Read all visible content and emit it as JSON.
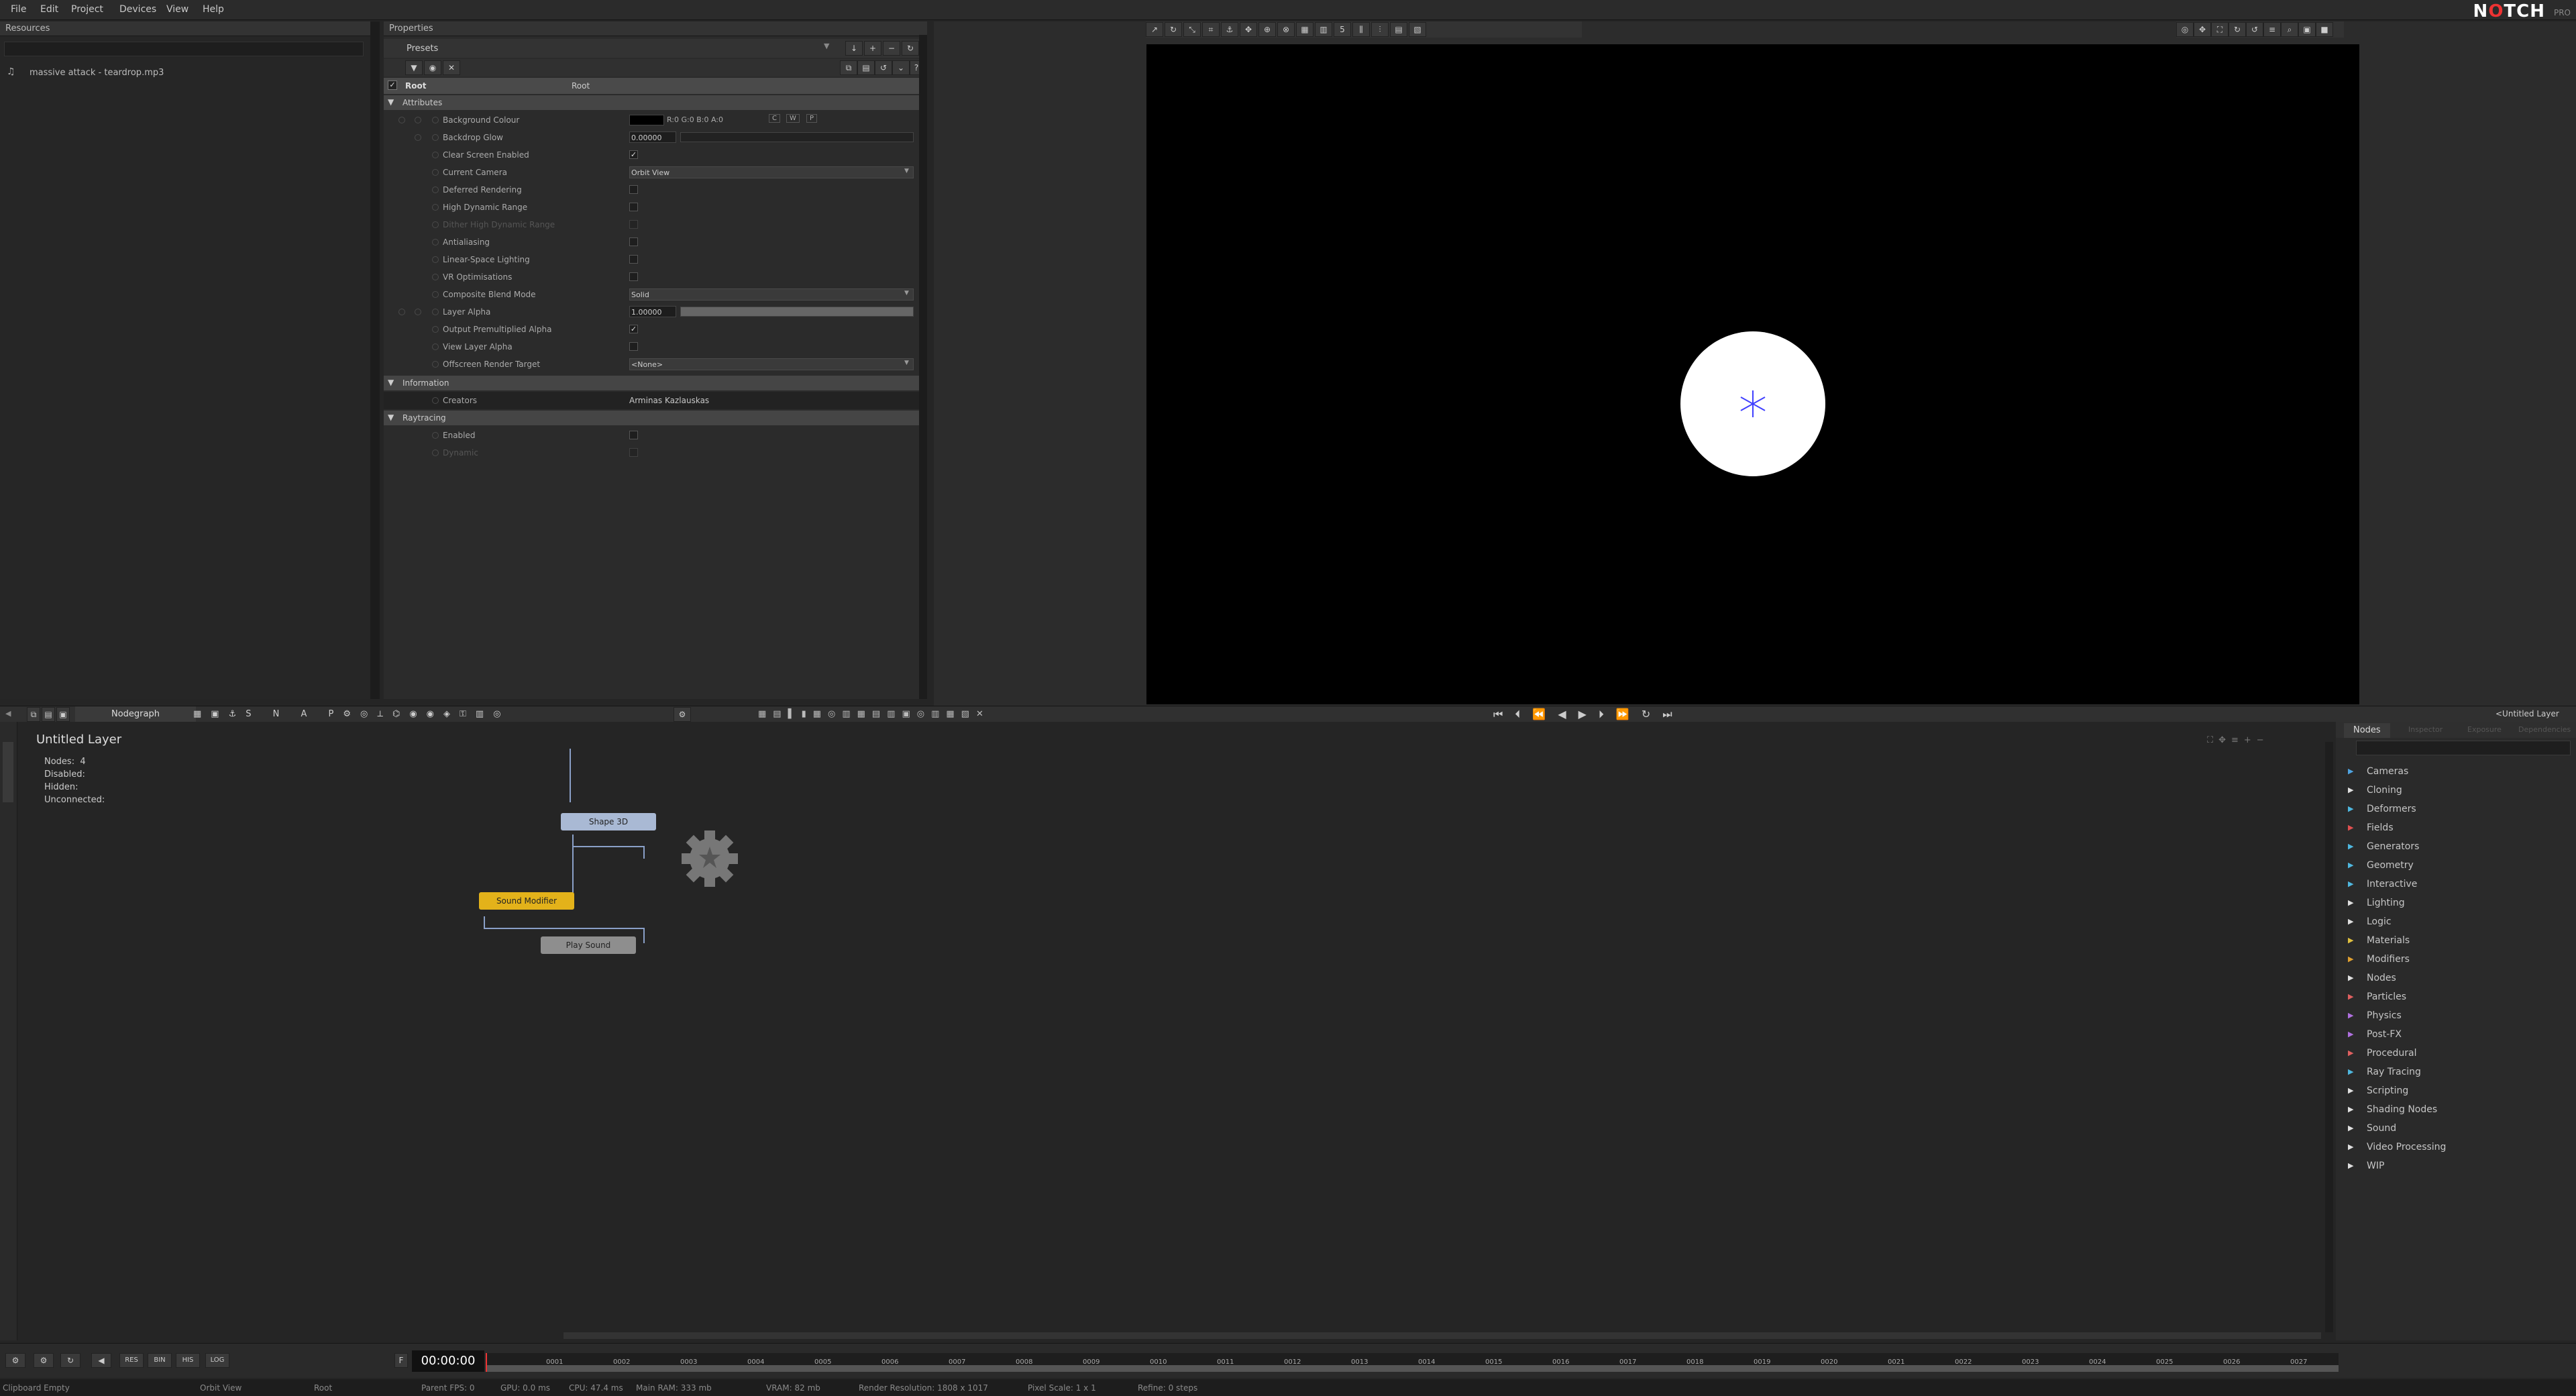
{
  "menu": [
    "File",
    "Edit",
    "Project",
    "Devices",
    "View",
    "Help"
  ],
  "brand": {
    "logo": "NOTCH",
    "edition": "PRO"
  },
  "resources": {
    "title": "Resources",
    "items": [
      {
        "icon": "music-note-icon",
        "label": "massive attack - teardrop.mp3"
      }
    ]
  },
  "properties": {
    "title": "Properties",
    "presets_label": "Presets",
    "root_label": "Root",
    "root_value": "Root",
    "sections": {
      "attributes": "Attributes",
      "information": "Information",
      "raytracing": "Raytracing"
    },
    "attributes": [
      {
        "label": "Background Colour",
        "type": "color",
        "value": "R:0 G:0 B:0 A:0",
        "extra": [
          "C",
          "W",
          "P"
        ]
      },
      {
        "label": "Backdrop Glow",
        "type": "slider",
        "value": "0.00000"
      },
      {
        "label": "Clear Screen Enabled",
        "type": "check",
        "checked": true
      },
      {
        "label": "Current Camera",
        "type": "select",
        "value": "Orbit View"
      },
      {
        "label": "Deferred Rendering",
        "type": "check",
        "checked": false
      },
      {
        "label": "High Dynamic Range",
        "type": "check",
        "checked": false
      },
      {
        "label": "Dither High Dynamic Range",
        "type": "check",
        "checked": false,
        "disabled": true
      },
      {
        "label": "Antialiasing",
        "type": "check",
        "checked": false
      },
      {
        "label": "Linear-Space Lighting",
        "type": "check",
        "checked": false
      },
      {
        "label": "VR Optimisations",
        "type": "check",
        "checked": false
      },
      {
        "label": "Composite Blend Mode",
        "type": "select",
        "value": "Solid"
      },
      {
        "label": "Layer Alpha",
        "type": "slider",
        "value": "1.00000"
      },
      {
        "label": "Output Premultiplied Alpha",
        "type": "check",
        "checked": true
      },
      {
        "label": "View Layer Alpha",
        "type": "check",
        "checked": false
      },
      {
        "label": "Offscreen Render Target",
        "type": "select",
        "value": "<None>"
      }
    ],
    "information": [
      {
        "label": "Creators",
        "value": "Arminas Kazlauskas"
      }
    ],
    "raytracing": [
      {
        "label": "Enabled",
        "checked": false
      },
      {
        "label": "Dynamic",
        "checked": false,
        "disabled": true
      }
    ]
  },
  "nodegraph": {
    "tab": "Nodegraph",
    "layer_title": "Untitled  Layer",
    "stats": [
      {
        "label": "Nodes:",
        "value": "4"
      },
      {
        "label": "Disabled:",
        "value": ""
      },
      {
        "label": "Hidden:",
        "value": ""
      },
      {
        "label": "Unconnected:",
        "value": ""
      }
    ],
    "nodes": {
      "shape": "Shape  3D",
      "modifier": "Sound  Modifier",
      "play": "Play  Sound"
    },
    "layer_tag": "<Untitled Layer"
  },
  "nodes_panel": {
    "tabs": [
      "Nodes",
      "Inspector",
      "Exposure",
      "Dependencies"
    ],
    "categories": [
      {
        "label": "Cameras",
        "color": "#4fa3e0"
      },
      {
        "label": "Cloning",
        "color": "#e0e0e0"
      },
      {
        "label": "Deformers",
        "color": "#4fb8e0"
      },
      {
        "label": "Fields",
        "color": "#e05050"
      },
      {
        "label": "Generators",
        "color": "#4fb8e0"
      },
      {
        "label": "Geometry",
        "color": "#4fb8e0"
      },
      {
        "label": "Interactive",
        "color": "#4fb8e0"
      },
      {
        "label": "Lighting",
        "color": "#e0e0e0"
      },
      {
        "label": "Logic",
        "color": "#e0e0e0"
      },
      {
        "label": "Materials",
        "color": "#e0c040"
      },
      {
        "label": "Modifiers",
        "color": "#e0a030"
      },
      {
        "label": "Nodes",
        "color": "#e0e0e0"
      },
      {
        "label": "Particles",
        "color": "#e06060"
      },
      {
        "label": "Physics",
        "color": "#b070e0"
      },
      {
        "label": "Post-FX",
        "color": "#b070e0"
      },
      {
        "label": "Procedural",
        "color": "#e06060"
      },
      {
        "label": "Ray Tracing",
        "color": "#4fb8e0"
      },
      {
        "label": "Scripting",
        "color": "#e0e0e0"
      },
      {
        "label": "Shading Nodes",
        "color": "#e0e0e0"
      },
      {
        "label": "Sound",
        "color": "#e0e0e0"
      },
      {
        "label": "Video Processing",
        "color": "#e0e0e0"
      },
      {
        "label": "WIP",
        "color": "#e0e0e0"
      }
    ]
  },
  "timeline": {
    "time": "00:00:00",
    "buttons": [
      "RES",
      "BIN",
      "HIS",
      "LOG"
    ],
    "ticks": [
      "0001",
      "0002",
      "0003",
      "0004",
      "0005",
      "0006",
      "0007",
      "0008",
      "0009",
      "0010",
      "0011",
      "0012",
      "0013",
      "0014",
      "0015",
      "0016",
      "0017",
      "0018",
      "0019",
      "0020",
      "0021",
      "0022",
      "0023",
      "0024",
      "0025",
      "0026",
      "0027"
    ]
  },
  "status": {
    "clipboard": "Clipboard Empty",
    "camera": "Orbit View",
    "layer": "Root",
    "fps": "Parent  FPS: 0",
    "gpu": "GPU: 0.0 ms",
    "cpu": "CPU: 47.4 ms",
    "ram": "Main RAM: 333 mb",
    "vram": "VRAM: 82 mb",
    "res": "Render Resolution: 1808 x 1017",
    "scale": "Pixel Scale: 1 x 1",
    "refine": "Refine: 0 steps"
  },
  "colors": {
    "node_shape": "#a9b9d4",
    "node_modifier": "#e3b21a",
    "node_play": "#8e8e8e",
    "viewport_bg": "#000000"
  }
}
